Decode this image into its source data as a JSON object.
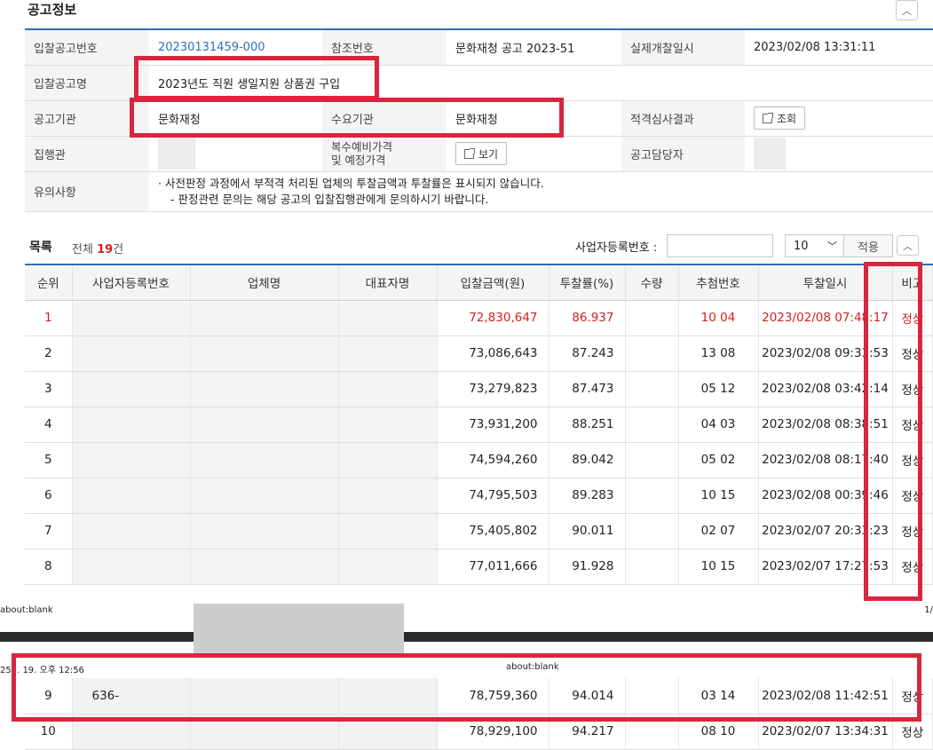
{
  "section_title": "공고정보",
  "info": {
    "bid_no_label": "입찰공고번호",
    "bid_no": "20230131459-000",
    "ref_no_label": "참조번호",
    "ref_no": "문화재청 공고 2023-51",
    "open_date_label": "실제개찰일시",
    "open_date": "2023/02/08 13:31:11",
    "bid_name_label": "입찰공고명",
    "bid_name": "2023년도 직원 생일지원 상품권 구입",
    "agency_label": "공고기관",
    "agency": "문화재청",
    "demand_label": "수요기관",
    "demand": "문화재청",
    "qual_label": "적격심사결과",
    "qual_btn": "조회",
    "exec_label": "집행관",
    "price_label_1": "복수예비가격",
    "price_label_2": "및 예정가격",
    "price_btn": "보기",
    "manager_label": "공고담당자",
    "notes_label": "유의사항",
    "note_1": "·  사전판정 과정에서 부적격 처리된 업체의 투찰금액과 투찰률은 표시되지 않습니다.",
    "note_2": "- 판정관련 문의는 해당 공고의 입찰집행관에게 문의하시기 바랍니다."
  },
  "list": {
    "title": "목록",
    "total_prefix": "전체 ",
    "total_count": "19",
    "total_suffix": "건",
    "biz_no_label": "사업자등록번호 :",
    "page_size": "10",
    "apply_label": "적용"
  },
  "columns": [
    "순위",
    "사업자등록번호",
    "업체명",
    "대표자명",
    "입찰금액(원)",
    "투찰률(%)",
    "수량",
    "추첨번호",
    "투찰일시",
    "비고"
  ],
  "rows": [
    {
      "rank": "1",
      "bizno": "",
      "amount": "72,830,647",
      "rate": "86.937",
      "draw": "10 04",
      "time": "2023/02/08 07:48:17",
      "note": "정상"
    },
    {
      "rank": "2",
      "bizno": "",
      "amount": "73,086,643",
      "rate": "87.243",
      "draw": "13 08",
      "time": "2023/02/08 09:33:53",
      "note": "정상"
    },
    {
      "rank": "3",
      "bizno": "",
      "amount": "73,279,823",
      "rate": "87.473",
      "draw": "05 12",
      "time": "2023/02/08 03:42:14",
      "note": "정상"
    },
    {
      "rank": "4",
      "bizno": "",
      "amount": "73,931,200",
      "rate": "88.251",
      "draw": "04 03",
      "time": "2023/02/08 08:38:51",
      "note": "정상"
    },
    {
      "rank": "5",
      "bizno": "",
      "amount": "74,594,260",
      "rate": "89.042",
      "draw": "05 02",
      "time": "2023/02/08 08:17:40",
      "note": "정상"
    },
    {
      "rank": "6",
      "bizno": "",
      "amount": "74,795,503",
      "rate": "89.283",
      "draw": "10 15",
      "time": "2023/02/08 00:39:46",
      "note": "정상"
    },
    {
      "rank": "7",
      "bizno": "",
      "amount": "75,405,802",
      "rate": "90.011",
      "draw": "02 07",
      "time": "2023/02/07 20:33:23",
      "note": "정상"
    },
    {
      "rank": "8",
      "bizno": "",
      "amount": "77,011,666",
      "rate": "91.928",
      "draw": "10 15",
      "time": "2023/02/07 17:27:53",
      "note": "정상"
    }
  ],
  "rows2": [
    {
      "rank": "9",
      "bizno": "636-",
      "amount": "78,759,360",
      "rate": "94.014",
      "draw": "03 14",
      "time": "2023/02/08 11:42:51",
      "note": "정상"
    },
    {
      "rank": "10",
      "bizno": "",
      "amount": "78,929,100",
      "rate": "94.217",
      "draw": "08 10",
      "time": "2023/02/07 13:34:31",
      "note": "정상"
    }
  ],
  "print": {
    "footer_left": "about:blank",
    "footer_right": "1/",
    "header_date": "25. . 19. 오후 12:56",
    "header_mid": "about:blank"
  },
  "colors": {
    "accent": "#2f6fb0",
    "highlight": "#d8263e",
    "first_rank": "#d42020"
  }
}
